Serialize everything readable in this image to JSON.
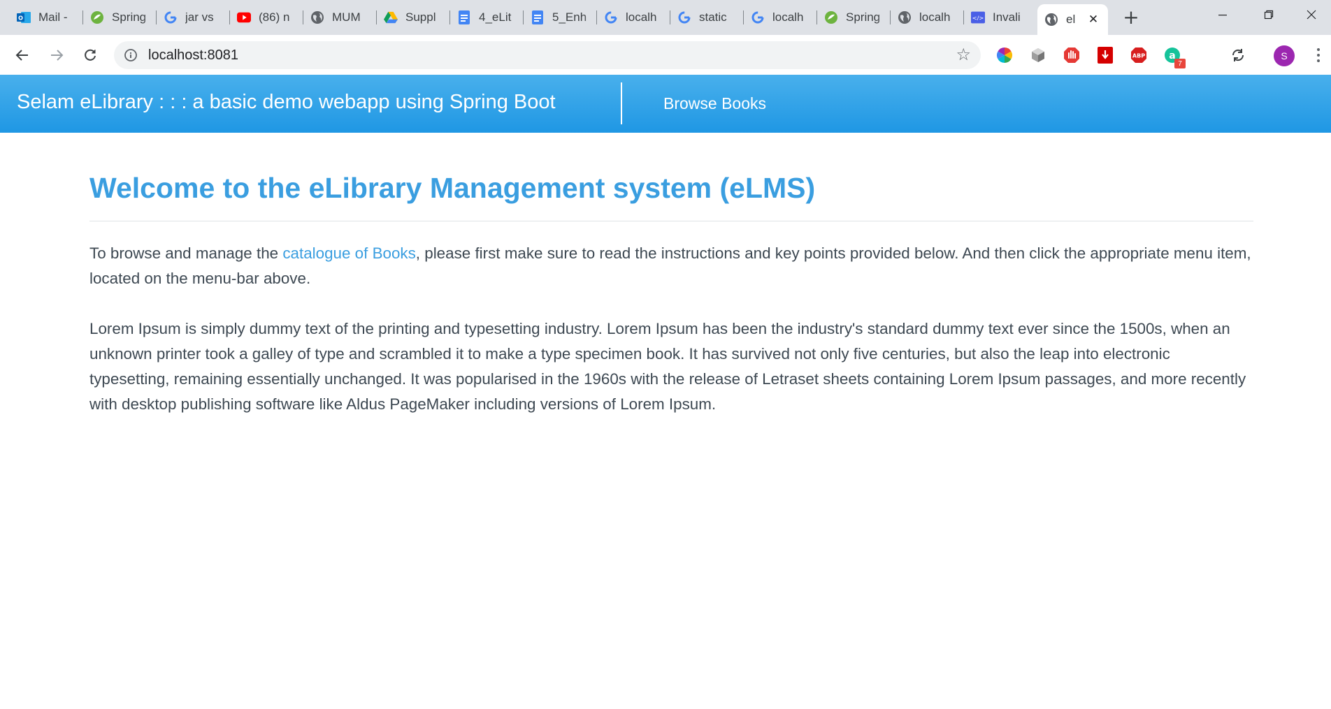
{
  "browser": {
    "tabs": [
      {
        "title": "Mail -",
        "icon": "outlook-icon"
      },
      {
        "title": "Spring",
        "icon": "spring-icon"
      },
      {
        "title": "jar vs",
        "icon": "google-icon"
      },
      {
        "title": "(86) n",
        "icon": "youtube-icon"
      },
      {
        "title": "MUM",
        "icon": "globe-icon"
      },
      {
        "title": "Suppl",
        "icon": "google-drive-icon"
      },
      {
        "title": "4_eLit",
        "icon": "google-docs-icon"
      },
      {
        "title": "5_Enh",
        "icon": "google-docs-icon"
      },
      {
        "title": "localh",
        "icon": "google-icon"
      },
      {
        "title": "static",
        "icon": "google-icon"
      },
      {
        "title": "localh",
        "icon": "google-icon"
      },
      {
        "title": "Spring",
        "icon": "spring-icon"
      },
      {
        "title": "localh",
        "icon": "globe-icon"
      },
      {
        "title": "Invali",
        "icon": "code-icon"
      }
    ],
    "active_tab": {
      "title": "el",
      "icon": "globe-icon"
    },
    "address": "localhost:8081",
    "profile_initial": "S",
    "extension_badge": "7"
  },
  "app": {
    "brand": "Selam eLibrary : : : a basic demo webapp using Spring Boot",
    "nav_link": "Browse Books"
  },
  "main": {
    "heading": "Welcome to the eLibrary Management system (eLMS)",
    "intro_before": "To browse and manage the ",
    "intro_link": "catalogue of Books",
    "intro_after": ", please first make sure to read the instructions and key points provided below. And then click the appropriate menu item, located on the menu-bar above.",
    "body": "Lorem Ipsum is simply dummy text of the printing and typesetting industry. Lorem Ipsum has been the industry's standard dummy text ever since the 1500s, when an unknown printer took a galley of type and scrambled it to make a type specimen book. It has survived not only five centuries, but also the leap into electronic typesetting, remaining essentially unchanged. It was popularised in the 1960s with the release of Letraset sheets containing Lorem Ipsum passages, and more recently with desktop publishing software like Aldus PageMaker including versions of Lorem Ipsum."
  },
  "colors": {
    "app_bar": "#2ea0e7",
    "accent": "#3a9ee0",
    "body_text": "#3d4852"
  }
}
